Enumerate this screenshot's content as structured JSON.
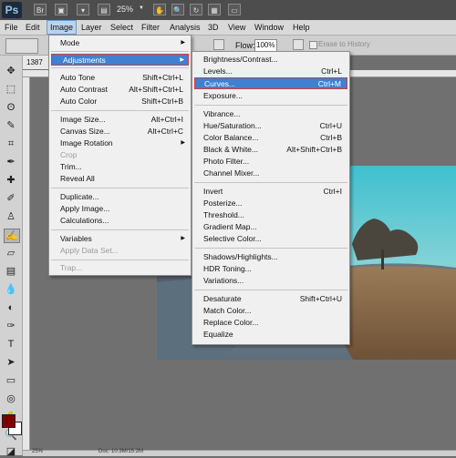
{
  "app": {
    "logo": "Ps",
    "zoom": "25%",
    "bar_icons": [
      "bridge-icon",
      "minibridge-icon",
      "guides-icon",
      "zoom-level-icon",
      "hand-icon",
      "zoom-icon",
      "rotate-view-icon",
      "arrange-documents-icon",
      "screen-mode-icon"
    ]
  },
  "menubar": {
    "items": [
      "File",
      "Edit",
      "Image",
      "Layer",
      "Select",
      "Filter",
      "Analysis",
      "3D",
      "View",
      "Window",
      "Help"
    ],
    "active": "Image"
  },
  "options": {
    "flow_label": "Flow:",
    "flow_value": "100%",
    "erase_to_history": "Erase to History"
  },
  "document": {
    "tab_label": "1387",
    "status_zoom": "25%",
    "status_doc": "Doc: 10.3M/15.2M"
  },
  "colors": {
    "foreground": "#7b0000",
    "background": "#ffffff",
    "highlight": "#3f80d0",
    "callout_border": "#d63a3a"
  },
  "image_menu": {
    "mode": "Mode",
    "adjustments": "Adjustments",
    "auto_tone": {
      "label": "Auto Tone",
      "shortcut": "Shift+Ctrl+L"
    },
    "auto_contrast": {
      "label": "Auto Contrast",
      "shortcut": "Alt+Shift+Ctrl+L"
    },
    "auto_color": {
      "label": "Auto Color",
      "shortcut": "Shift+Ctrl+B"
    },
    "image_size": {
      "label": "Image Size...",
      "shortcut": "Alt+Ctrl+I"
    },
    "canvas_size": {
      "label": "Canvas Size...",
      "shortcut": "Alt+Ctrl+C"
    },
    "image_rotation": "Image Rotation",
    "crop": "Crop",
    "trim": "Trim...",
    "reveal_all": "Reveal All",
    "duplicate": "Duplicate...",
    "apply_image": "Apply Image...",
    "calculations": "Calculations...",
    "variables": "Variables",
    "apply_data_set": "Apply Data Set...",
    "trap": "Trap..."
  },
  "adjustments_menu": {
    "brightness_contrast": "Brightness/Contrast...",
    "levels": {
      "label": "Levels...",
      "shortcut": "Ctrl+L"
    },
    "curves": {
      "label": "Curves...",
      "shortcut": "Ctrl+M"
    },
    "exposure": "Exposure...",
    "vibrance": "Vibrance...",
    "hue_saturation": {
      "label": "Hue/Saturation...",
      "shortcut": "Ctrl+U"
    },
    "color_balance": {
      "label": "Color Balance...",
      "shortcut": "Ctrl+B"
    },
    "black_white": {
      "label": "Black & White...",
      "shortcut": "Alt+Shift+Ctrl+B"
    },
    "photo_filter": "Photo Filter...",
    "channel_mixer": "Channel Mixer...",
    "invert": {
      "label": "Invert",
      "shortcut": "Ctrl+I"
    },
    "posterize": "Posterize...",
    "threshold": "Threshold...",
    "gradient_map": "Gradient Map...",
    "selective_color": "Selective Color...",
    "shadows_highlights": "Shadows/Highlights...",
    "hdr_toning": "HDR Toning...",
    "variations": "Variations...",
    "desaturate": {
      "label": "Desaturate",
      "shortcut": "Shift+Ctrl+U"
    },
    "match_color": "Match Color...",
    "replace_color": "Replace Color...",
    "equalize": "Equalize"
  }
}
